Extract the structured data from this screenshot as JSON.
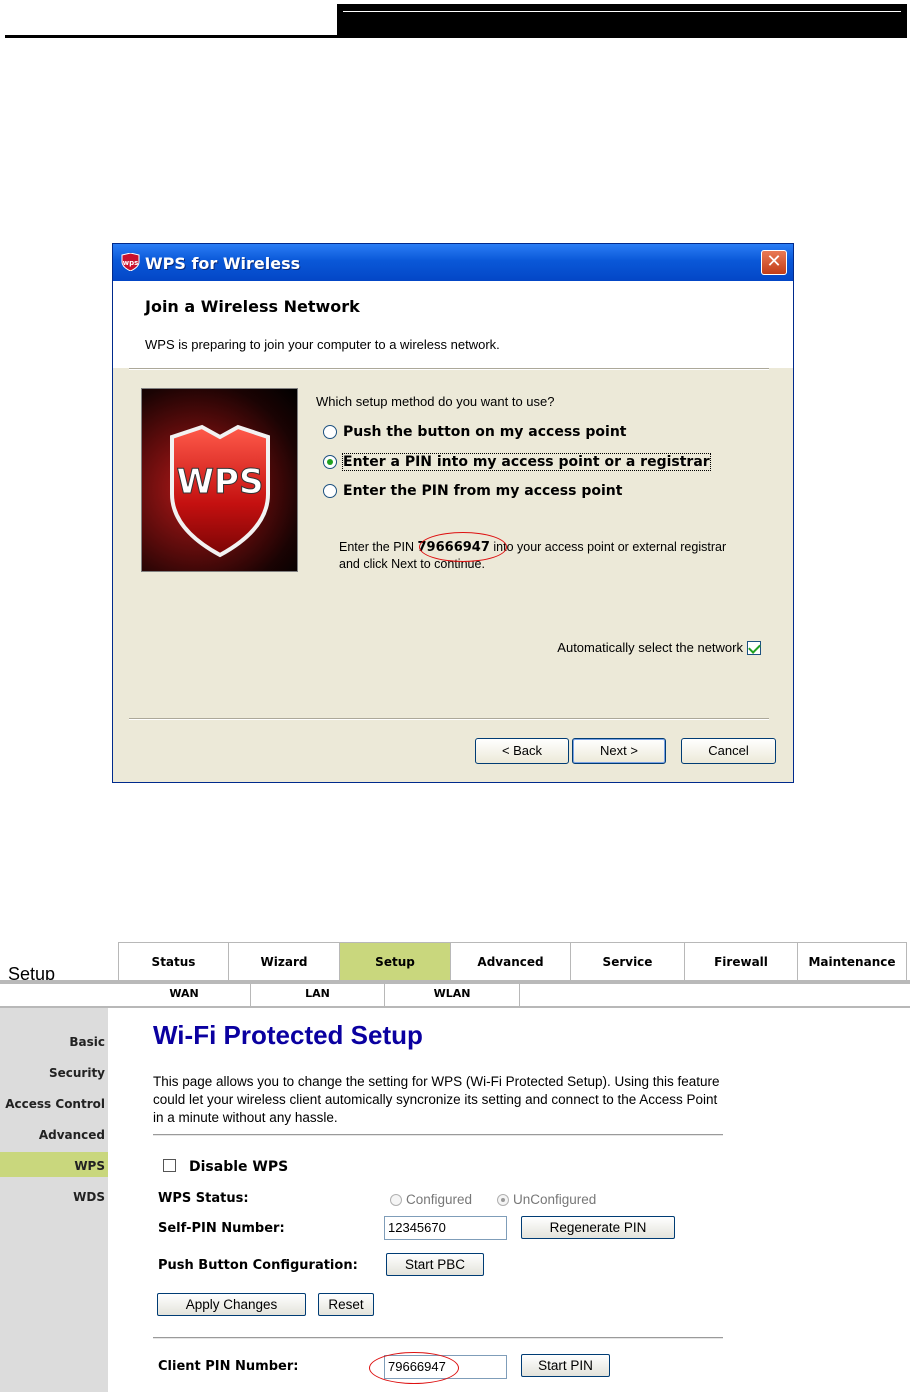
{
  "dialog": {
    "title": "WPS for Wireless",
    "close_glyph": "✕",
    "header_title": "Join a Wireless Network",
    "header_subtitle": "WPS is preparing to join your computer to a wireless network.",
    "logo_text": "WPS",
    "question": "Which setup method do you want to use?",
    "options": [
      {
        "label": "Push the button on my access point",
        "selected": false
      },
      {
        "label": "Enter a PIN into my access point or a registrar",
        "selected": true
      },
      {
        "label": "Enter the PIN from my access point",
        "selected": false
      }
    ],
    "pin_prefix": "Enter the PIN ",
    "pin": "79666947",
    "pin_suffix": " into your access point or external registrar",
    "pin_line2": "and click Next to continue.",
    "auto_select_label": "Automatically select the network",
    "auto_select_checked": true,
    "buttons": {
      "back": "< Back",
      "next": "Next >",
      "cancel": "Cancel"
    }
  },
  "router": {
    "section_label": "Setup",
    "nav_tabs": [
      "Status",
      "Wizard",
      "Setup",
      "Advanced",
      "Service",
      "Firewall",
      "Maintenance"
    ],
    "active_tab": "Setup",
    "sub_tabs": [
      "WAN",
      "LAN",
      "WLAN"
    ],
    "sidebar": [
      "Basic",
      "Security",
      "Access Control",
      "Advanced",
      "WPS",
      "WDS"
    ],
    "active_sidebar": "WPS",
    "page_title": "Wi-Fi Protected Setup",
    "description": "This page allows you to change the setting for WPS (Wi-Fi Protected Setup). Using this feature could let your wireless client automically syncronize its setting and connect to the Access Point in a minute without any hassle.",
    "disable_wps_label": "Disable WPS",
    "wps_status_label": "WPS Status:",
    "status_options": [
      "Configured",
      "UnConfigured"
    ],
    "status_selected": "UnConfigured",
    "self_pin_label": "Self-PIN Number:",
    "self_pin_value": "12345670",
    "regenerate_pin_button": "Regenerate PIN",
    "pbc_label": "Push Button Configuration:",
    "start_pbc_button": "Start PBC",
    "apply_button": "Apply Changes",
    "reset_button": "Reset",
    "client_pin_label": "Client PIN Number:",
    "client_pin_value": "79666947",
    "start_pin_button": "Start PIN"
  },
  "colors": {
    "xp_title_blue": "#0a58d8",
    "router_highlight": "#c9d77d",
    "router_title": "#0a00a0",
    "annotation_red": "#dd1111"
  }
}
